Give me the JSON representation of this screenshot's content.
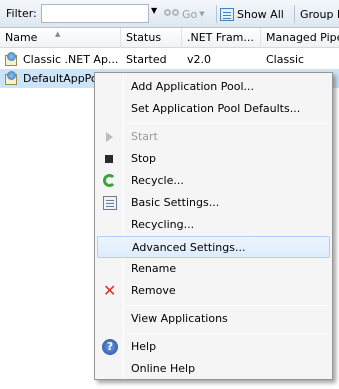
{
  "toolbar": {
    "filter_label": "Filter:",
    "filter_value": "",
    "go_label": "Go",
    "show_all_label": "Show All",
    "group_by_label": "Group b"
  },
  "columns": [
    "Name",
    "Status",
    ".NET Fram...",
    "Managed Pipe"
  ],
  "rows": [
    {
      "name": "Classic .NET Ap...",
      "status": "Started",
      "net": "v2.0",
      "pipeline": "Classic"
    },
    {
      "name": "DefaultAppPo",
      "status": "",
      "net": "",
      "pipeline": ""
    }
  ],
  "context_menu": {
    "items": [
      {
        "label": "Add Application Pool...",
        "icon": "none",
        "enabled": true
      },
      {
        "label": "Set Application Pool Defaults...",
        "icon": "none",
        "enabled": true
      },
      {
        "label": "Start",
        "icon": "play-icon",
        "enabled": false
      },
      {
        "label": "Stop",
        "icon": "stop-icon",
        "enabled": true
      },
      {
        "label": "Recycle...",
        "icon": "recycle-icon",
        "enabled": true
      },
      {
        "label": "Basic Settings...",
        "icon": "settings-sheet-icon",
        "enabled": true
      },
      {
        "label": "Recycling...",
        "icon": "none",
        "enabled": true
      },
      {
        "label": "Advanced Settings...",
        "icon": "none",
        "enabled": true,
        "highlighted": true
      },
      {
        "label": "Rename",
        "icon": "none",
        "enabled": true
      },
      {
        "label": "Remove",
        "icon": "remove-icon",
        "enabled": true
      },
      {
        "label": "View Applications",
        "icon": "none",
        "enabled": true
      },
      {
        "label": "Help",
        "icon": "help-icon",
        "enabled": true
      },
      {
        "label": "Online Help",
        "icon": "none",
        "enabled": true
      }
    ]
  },
  "colors": {
    "selection": "#cce4f7",
    "highlight_border": "#aecff7",
    "remove_red": "#d9322b",
    "recycle_green": "#3aa53a"
  }
}
